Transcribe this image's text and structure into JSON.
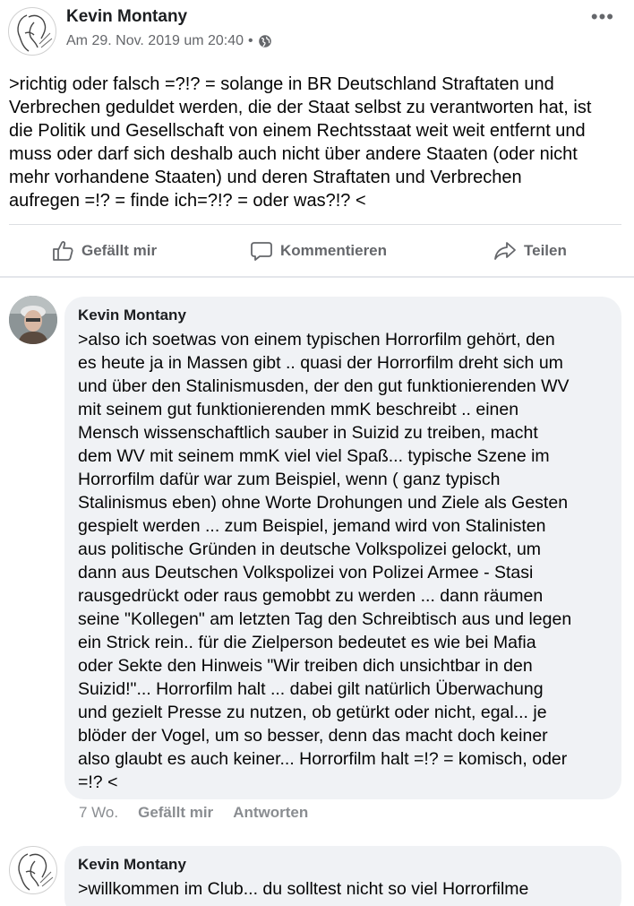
{
  "post": {
    "author": "Kevin Montany",
    "timestamp": "Am 29. Nov. 2019 um 20:40",
    "separator": "•",
    "privacy_icon": "globe-icon",
    "more_label": "•••",
    "text_lines": [
      ">richtig oder falsch =?!? = solange in BR Deutschland Straftaten und",
      "Verbrechen geduldet werden, die der Staat selbst  zu verantworten hat, ist",
      "die Politik und Gesellschaft von einem Rechtsstaat weit weit entfernt und",
      "muss oder darf sich deshalb auch nicht über andere Staaten  (oder nicht",
      "mehr vorhandene Staaten) und deren Straftaten und Verbrechen",
      "aufregen =!? = finde ich=?!? = oder was?!? <"
    ]
  },
  "actions": {
    "like_label": "Gefällt mir",
    "comment_label": "Kommentieren",
    "share_label": "Teilen"
  },
  "comments": [
    {
      "author": "Kevin Montany",
      "text_lines": [
        ">also ich soetwas von einem typischen Horrorfilm gehört, den",
        "es heute ja in Massen gibt .. quasi der Horrorfilm  dreht sich um",
        "und über den Stalinismusden, der den gut funktionierenden WV",
        "mit seinem gut funktionierenden mmK beschreibt ..  einen",
        "Mensch wissenschaftlich sauber in Suizid zu treiben, macht",
        "dem WV mit seinem mmK  viel viel Spaß... typische Szene im",
        "Horrorfilm dafür war zum Beispiel, wenn ( ganz typisch",
        "Stalinismus eben) ohne Worte Drohungen und Ziele als Gesten",
        "gespielt werden ... zum Beispiel,  jemand wird von Stalinisten",
        "aus politische Gründen in deutsche Volkspolizei gelockt, um",
        "dann aus Deutschen Volkspolizei von Polizei Armee - Stasi",
        "rausgedrückt oder raus gemobbt zu werden ... dann räumen",
        "seine \"Kollegen\" am letzten Tag den Schreibtisch aus und legen",
        "ein Strick rein.. für die Zielperson bedeutet es wie bei Mafia",
        "oder Sekte den Hinweis \"Wir treiben dich unsichtbar in den",
        "Suizid!\"... Horrorfilm halt ... dabei gilt natürlich Überwachung",
        "und gezielt Presse zu nutzen, ob getürkt oder nicht, egal... je",
        "blöder der Vogel, um so besser, denn das macht doch keiner",
        "also glaubt es auch keiner... Horrorfilm halt =!? = komisch, oder",
        "=!? <"
      ],
      "age": "7 Wo.",
      "like_label": "Gefällt mir",
      "reply_label": "Antworten"
    },
    {
      "author": "Kevin Montany",
      "text_lines": [
        ">willkommen im Club... du solltest nicht so viel Horrorfilme"
      ]
    }
  ],
  "colors": {
    "secondary_text": "#65676b",
    "bubble_bg": "#f0f2f5",
    "divider": "#dddfe2"
  }
}
